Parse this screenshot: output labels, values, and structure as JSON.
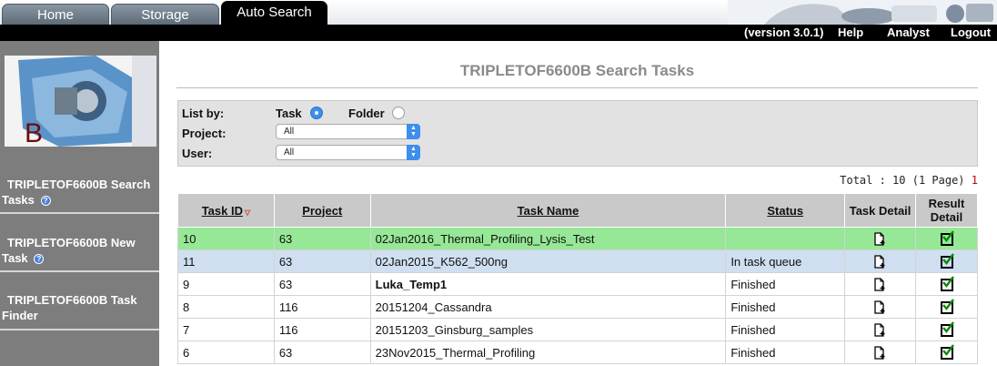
{
  "tabs": [
    {
      "label": "Home",
      "active": false
    },
    {
      "label": "Storage",
      "active": false
    },
    {
      "label": "Auto Search",
      "active": true
    }
  ],
  "menu": {
    "version": "(version 3.0.1)",
    "help": "Help",
    "analyst": "Analyst",
    "logout": "Logout"
  },
  "sidebar": {
    "logo_letter": "B",
    "items": [
      {
        "label": "TRIPLETOF6600B Search Tasks",
        "help_icon": true
      },
      {
        "label": "TRIPLETOF6600B New Task",
        "help_icon": true
      },
      {
        "label": "TRIPLETOF6600B Task Finder",
        "help_icon": false
      }
    ]
  },
  "main": {
    "title": "TRIPLETOF6600B Search Tasks",
    "filter": {
      "list_by_label": "List by:",
      "option_task": "Task",
      "option_folder": "Folder",
      "selected": "Task",
      "project_label": "Project:",
      "project_value": "All",
      "user_label": "User:",
      "user_value": "All"
    },
    "total_text": "Total : 10 (1 Page)",
    "page_link": "1"
  },
  "table": {
    "headers": {
      "task_id": "Task ID",
      "project": "Project",
      "task_name": "Task Name",
      "status": "Status",
      "task_detail": "Task Detail",
      "result_detail_1": "Result",
      "result_detail_2": "Detail"
    },
    "rows": [
      {
        "task_id": "10",
        "project": "63",
        "task_name": "02Jan2016_Thermal_Profiling_Lysis_Test",
        "status": "",
        "style": "highlight"
      },
      {
        "task_id": "11",
        "project": "63",
        "task_name": "02Jan2015_K562_500ng",
        "status": "In task queue",
        "style": "selected"
      },
      {
        "task_id": "9",
        "project": "63",
        "task_name": "Luka_Temp1",
        "status": "Finished",
        "style": "bold-name"
      },
      {
        "task_id": "8",
        "project": "116",
        "task_name": "20151204_Cassandra",
        "status": "Finished",
        "style": ""
      },
      {
        "task_id": "7",
        "project": "116",
        "task_name": "20151203_Ginsburg_samples",
        "status": "Finished",
        "style": ""
      },
      {
        "task_id": "6",
        "project": "63",
        "task_name": "23Nov2015_Thermal_Profiling",
        "status": "Finished",
        "style": ""
      }
    ]
  },
  "icons": {
    "task_detail": "document-add-icon",
    "result_detail": "checkbox-checked-icon",
    "sort": "sort-down-icon",
    "help": "help-icon"
  },
  "colors": {
    "highlight_row": "#96e896",
    "selected_row": "#cfdff0",
    "header_bg": "#c9c9c9",
    "sidebar_bg": "#7d7d7d",
    "radio_on": "#3b8fee"
  }
}
